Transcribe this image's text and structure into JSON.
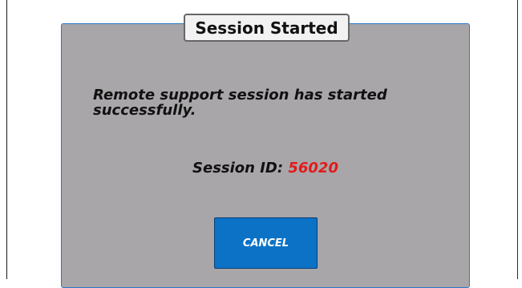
{
  "dialog": {
    "title": "Session Started",
    "message": "Remote support session has started successfully.",
    "session_id_label": "Session ID:",
    "session_id_value": "56020",
    "cancel_label": "CANCEL"
  },
  "colors": {
    "dialog_background": "#a8a6a8",
    "dialog_border": "#2f78c4",
    "session_id_value": "#e21b1b",
    "cancel_button": "#0b72c6"
  }
}
